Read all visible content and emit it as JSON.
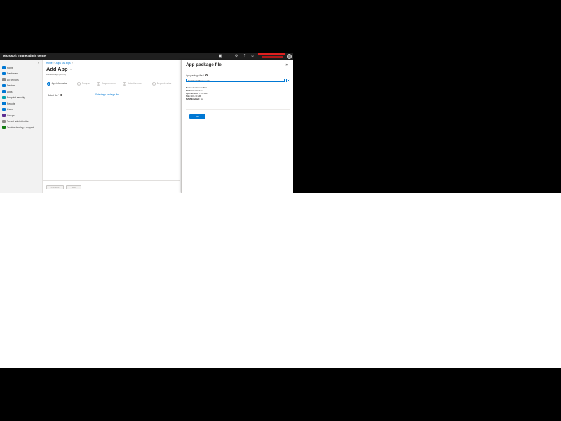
{
  "header": {
    "app_title": "Microsoft Intune admin center",
    "icons": [
      "screen-share-icon",
      "bell-icon",
      "gear-icon",
      "help-icon",
      "feedback-icon"
    ]
  },
  "leftnav": {
    "items": [
      {
        "label": "Home",
        "icon": "home-icon"
      },
      {
        "label": "Dashboard",
        "icon": "dashboard-icon"
      },
      {
        "label": "All services",
        "icon": "all-services-icon"
      },
      {
        "label": "Devices",
        "icon": "devices-icon"
      },
      {
        "label": "Apps",
        "icon": "apps-icon"
      },
      {
        "label": "Endpoint security",
        "icon": "shield-icon"
      },
      {
        "label": "Reports",
        "icon": "reports-icon"
      },
      {
        "label": "Users",
        "icon": "users-icon"
      },
      {
        "label": "Groups",
        "icon": "groups-icon"
      },
      {
        "label": "Tenant administration",
        "icon": "tenant-icon"
      },
      {
        "label": "Troubleshooting + support",
        "icon": "troubleshooting-icon"
      }
    ]
  },
  "main": {
    "breadcrumb": [
      "Home",
      "Apps | All apps"
    ],
    "title": "Add App",
    "subtitle": "Windows app (Win32)",
    "steps": [
      {
        "num": "1",
        "label": "App information"
      },
      {
        "num": "2",
        "label": "Program"
      },
      {
        "num": "3",
        "label": "Requirements"
      },
      {
        "num": "4",
        "label": "Detection rules"
      },
      {
        "num": "5",
        "label": "Dependencies"
      }
    ],
    "select_file_label": "Select file *",
    "select_link": "Select app package file",
    "previous_label": "Previous",
    "next_label": "Next"
  },
  "panel": {
    "title": "App package file",
    "package_label": "App package file *",
    "package_value": "FortiClientVPN.intunewin",
    "meta": {
      "name_key": "Name:",
      "name_val": "FortiClient VPN",
      "platform_key": "Platform:",
      "platform_val": "Windows",
      "version_key": "App version:",
      "version_val": "7.0.0.0437",
      "size_key": "Size:",
      "size_val": "105.30 MiB",
      "mam_key": "MAM Enabled:",
      "mam_val": "No"
    },
    "ok_label": "OK"
  },
  "colors": {
    "accent": "#0078d4",
    "header_bg": "#1f1f1f",
    "nav_bg": "#f2f2f2"
  }
}
